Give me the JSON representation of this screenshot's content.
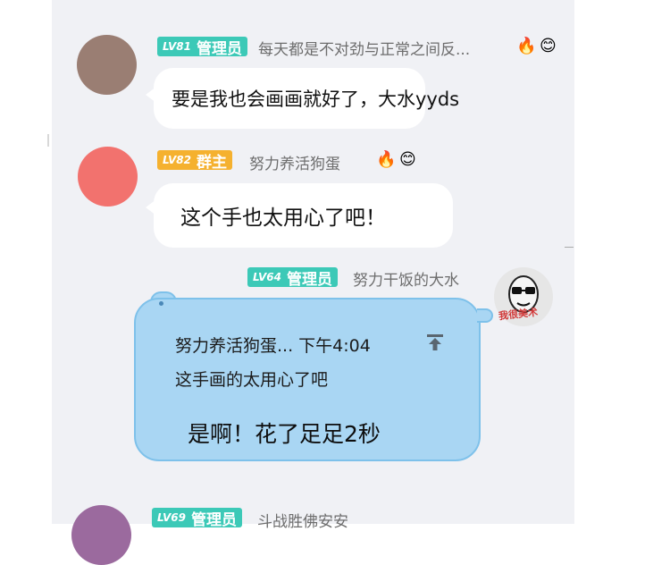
{
  "messages": [
    {
      "level": "LV81",
      "role": "管理员",
      "nickname": "每天都是不对劲与正常之间反...",
      "text": "要是我也会画画就好了，大水yyds",
      "avatar_color": "#9a7e73",
      "badge_color": "#3cc9b7",
      "icons": [
        "fire-icon",
        "smile-flower-icon"
      ]
    },
    {
      "level": "LV82",
      "role": "群主",
      "nickname": "努力养活狗蛋",
      "text": "这个手也太用心了吧！",
      "avatar_color": "#f2726e",
      "badge_color": "#f5b12f",
      "icons": [
        "fire-icon",
        "smile-flower-icon"
      ]
    },
    {
      "level": "LV64",
      "role": "管理员",
      "nickname": "努力干饭的大水",
      "quote_author": "努力养活狗蛋... 下午4:04",
      "quote_text": "这手画的太用心了吧",
      "text": "是啊！花了足足2秒",
      "avatar_sticker_text": "我很美术",
      "bubble_color": "#a9d6f3"
    },
    {
      "level": "LV69",
      "role": "管理员",
      "nickname": "斗战胜佛安安",
      "avatar_color": "#9b6a9e"
    }
  ]
}
